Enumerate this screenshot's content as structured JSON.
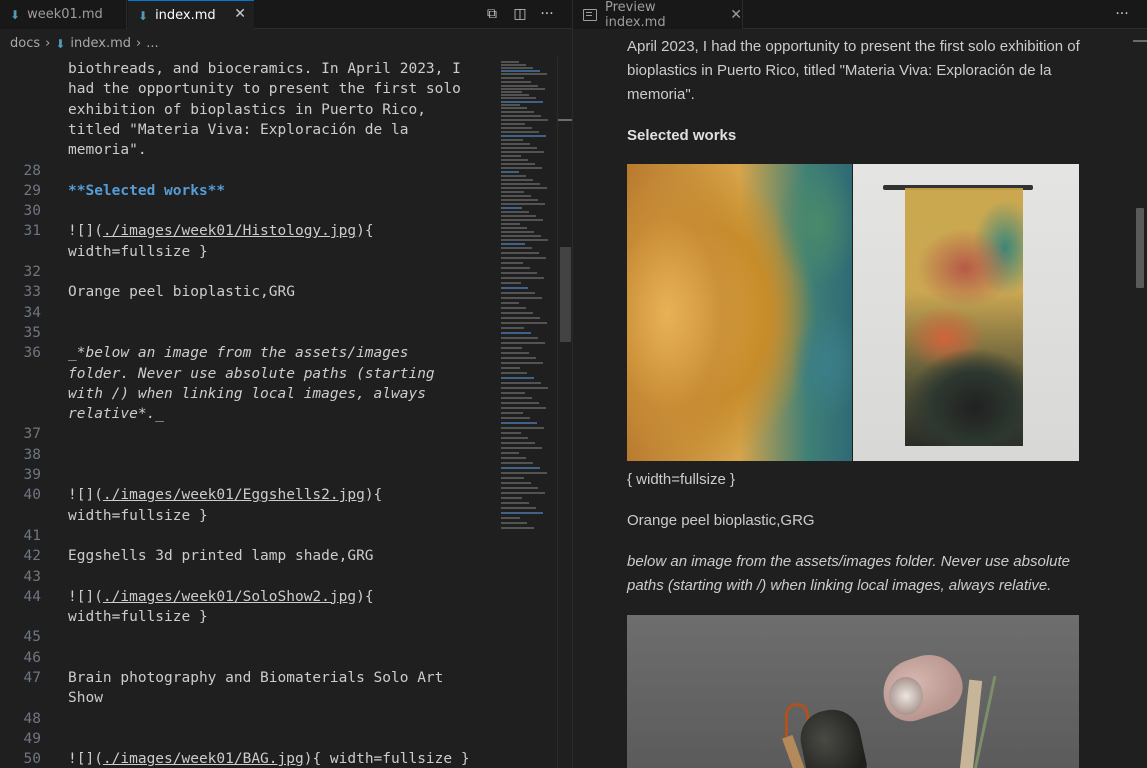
{
  "left_editor": {
    "tabs": [
      {
        "label": "week01.md",
        "active": false
      },
      {
        "label": "index.md",
        "active": true
      }
    ],
    "close_glyph": "✕",
    "toolbar": {
      "open_preview": "⧉",
      "split": "◫",
      "more": "···"
    },
    "breadcrumb": {
      "folder": "docs",
      "file": "index.md",
      "rest": "...",
      "sep": "›"
    },
    "lines": [
      {
        "n": "",
        "text": "biothreads, and bioceramics. In April 2023, I"
      },
      {
        "n": "",
        "text": "had the opportunity to present the first solo"
      },
      {
        "n": "",
        "text": "exhibition of bioplastics in Puerto Rico,"
      },
      {
        "n": "",
        "text": "titled \"Materia Viva: Exploración de la"
      },
      {
        "n": "",
        "text": "memoria\"."
      },
      {
        "n": "28",
        "text": ""
      },
      {
        "n": "29",
        "text": "**Selected works**"
      },
      {
        "n": "30",
        "text": ""
      },
      {
        "n": "31",
        "pre": "![](",
        "link": "./images/week01/Histology.jpg",
        "post": "){"
      },
      {
        "n": "",
        "text": "width=fullsize }"
      },
      {
        "n": "32",
        "text": ""
      },
      {
        "n": "33",
        "text": "Orange peel bioplastic,GRG"
      },
      {
        "n": "34",
        "text": ""
      },
      {
        "n": "35",
        "text": ""
      },
      {
        "n": "36",
        "text": "_*below an image from the assets/images"
      },
      {
        "n": "",
        "text": "folder. Never use absolute paths (starting"
      },
      {
        "n": "",
        "text": "with /) when linking local images, always"
      },
      {
        "n": "",
        "text": "relative*._"
      },
      {
        "n": "37",
        "text": ""
      },
      {
        "n": "38",
        "text": ""
      },
      {
        "n": "39",
        "text": ""
      },
      {
        "n": "40",
        "pre": "![](",
        "link": "./images/week01/Eggshells2.jpg",
        "post": "){"
      },
      {
        "n": "",
        "text": "width=fullsize }"
      },
      {
        "n": "41",
        "text": ""
      },
      {
        "n": "42",
        "text": "Eggshells 3d printed lamp shade,GRG"
      },
      {
        "n": "43",
        "text": ""
      },
      {
        "n": "44",
        "pre": "![](",
        "link": "./images/week01/SoloShow2.jpg",
        "post": "){"
      },
      {
        "n": "",
        "text": "width=fullsize }"
      },
      {
        "n": "45",
        "text": ""
      },
      {
        "n": "46",
        "text": ""
      },
      {
        "n": "47",
        "text": "Brain photography and Biomaterials Solo Art"
      },
      {
        "n": "",
        "text": "Show"
      },
      {
        "n": "48",
        "text": ""
      },
      {
        "n": "49",
        "text": ""
      },
      {
        "n": "50",
        "pre": "![](",
        "link": "./images/week01/BAG.jpg",
        "post": "){ width=fullsize }"
      }
    ]
  },
  "preview": {
    "tab_label": "Preview index.md",
    "close_glyph": "✕",
    "more": "···",
    "para_intro": "April 2023, I had the opportunity to present the first solo exhibition of bioplastics in Puerto Rico, titled \"Materia Viva: Exploración de la memoria\".",
    "heading_selected": "Selected works",
    "width_note": "{ width=fullsize }",
    "caption_orange": "Orange peel bioplastic,GRG",
    "italic_note": "below an image from the assets/images folder. Never use absolute paths (starting with /) when linking local images, always relative."
  }
}
